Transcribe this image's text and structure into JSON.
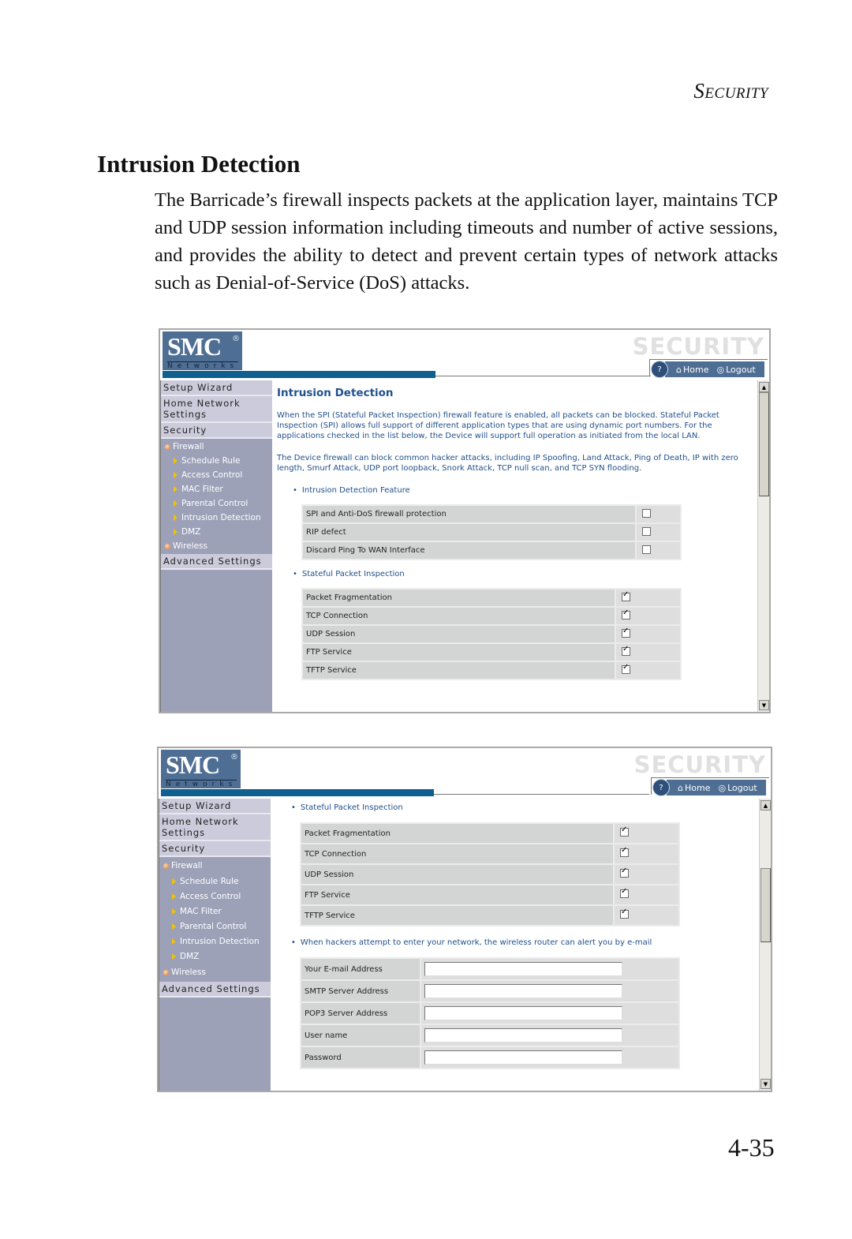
{
  "page": {
    "running_head": "Security",
    "section_title": "Intrusion Detection",
    "intro": "The Barricade’s firewall inspects packets at the application layer, maintains TCP and UDP session information including timeouts and number of active sessions, and provides the ability to detect and prevent certain types of network attacks such as Denial-of-Service (DoS) attacks.",
    "page_number": "4-35"
  },
  "ui": {
    "logo": "SMC",
    "logo_reg": "®",
    "logo_sub": "Networks",
    "watermark": "SECURITY",
    "help_label": "HELP",
    "home_label": "Home",
    "logout_label": "Logout",
    "sidebar": {
      "setup_wizard": "Setup Wizard",
      "home_network": "Home Network Settings",
      "security": "Security",
      "firewall": "Firewall",
      "sub_items": [
        "Schedule Rule",
        "Access Control",
        "MAC Filter",
        "Parental Control",
        "Intrusion Detection",
        "DMZ"
      ],
      "wireless": "Wireless",
      "advanced": "Advanced Settings"
    }
  },
  "screen1": {
    "title": "Intrusion Detection",
    "para1": "When the SPI (Stateful Packet Inspection) firewall feature is enabled, all packets can be blocked.  Stateful Packet Inspection (SPI) allows full support of different application types that are using dynamic port numbers.  For the applications checked in the list below, the Device will support full operation as initiated from the local LAN.",
    "para2": "The Device firewall can block common hacker attacks, including IP Spoofing, Land Attack, Ping of Death, IP with zero length, Smurf Attack, UDP port loopback, Snork Attack, TCP null scan, and TCP SYN flooding.",
    "feature_heading": "Intrusion Detection Feature",
    "features": [
      {
        "label": "SPI and Anti-DoS firewall protection",
        "checked": false
      },
      {
        "label": "RIP defect",
        "checked": false
      },
      {
        "label": "Discard Ping To WAN Interface",
        "checked": false
      }
    ],
    "spi_heading": "Stateful Packet Inspection",
    "spi": [
      {
        "label": "Packet Fragmentation",
        "checked": true
      },
      {
        "label": "TCP Connection",
        "checked": true
      },
      {
        "label": "UDP Session",
        "checked": true
      },
      {
        "label": "FTP Service",
        "checked": true
      },
      {
        "label": "TFTP  Service",
        "checked": true
      }
    ]
  },
  "screen2": {
    "spi_heading": "Stateful Packet Inspection",
    "spi": [
      {
        "label": "Packet Fragmentation",
        "checked": true
      },
      {
        "label": "TCP Connection",
        "checked": true
      },
      {
        "label": "UDP Session",
        "checked": true
      },
      {
        "label": "FTP Service",
        "checked": true
      },
      {
        "label": "TFTP  Service",
        "checked": true
      }
    ],
    "alert_heading": "When hackers attempt to enter your network, the wireless router can alert you by e-mail",
    "fields": [
      {
        "label": "Your E-mail Address",
        "value": ""
      },
      {
        "label": "SMTP Server Address",
        "value": ""
      },
      {
        "label": "POP3 Server Address",
        "value": ""
      },
      {
        "label": "User name",
        "value": ""
      },
      {
        "label": "Password",
        "value": ""
      }
    ]
  }
}
